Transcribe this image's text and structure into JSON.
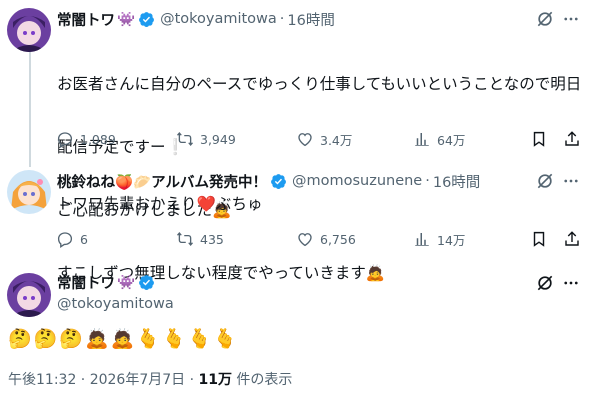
{
  "tweet1": {
    "name": "常闇トワ",
    "name_emoji": "👾",
    "handle": "@tokoyamitowa",
    "time": "16時間",
    "lines": [
      "お医者さんに自分のペースでゆっくり仕事してもいいということなので明日",
      "配信予定ですー❕",
      "ご心配おかけしました🙇",
      "すこしずつ無理しない程度でやっていきます🙇"
    ],
    "replies": "1,089",
    "reposts": "3,949",
    "likes": "3.4万",
    "views": "64万"
  },
  "tweet2": {
    "name": "桃鈴ねね🍑🥟アルバム発売中！",
    "handle": "@momosuzunene",
    "time": "16時間",
    "text": "トワワ先輩おかえり❤️ぶちゅ",
    "replies": "6",
    "reposts": "435",
    "likes": "6,756",
    "views": "14万"
  },
  "tweet3": {
    "name": "常闇トワ",
    "name_emoji": "👾",
    "handle": "@tokoyamitowa",
    "emojis": [
      "🤔",
      "🤔",
      "🤔",
      "🙇",
      "🙇",
      "🫰",
      "🫰",
      "🫰",
      "🫰"
    ],
    "timestamp": "午後11:32 · 2026年7月7日 · ",
    "view_count": "11万",
    "view_label": " 件の表示"
  },
  "colors": {
    "verified": "#1d9bf0",
    "text": "#0f1419",
    "muted": "#536471",
    "line": "#cfd9de",
    "heart": "#f91880"
  },
  "icons": [
    "verified-badge-icon",
    "grok-icon",
    "more-icon",
    "reply-icon",
    "repost-icon",
    "like-icon",
    "views-icon",
    "bookmark-icon",
    "share-icon"
  ]
}
